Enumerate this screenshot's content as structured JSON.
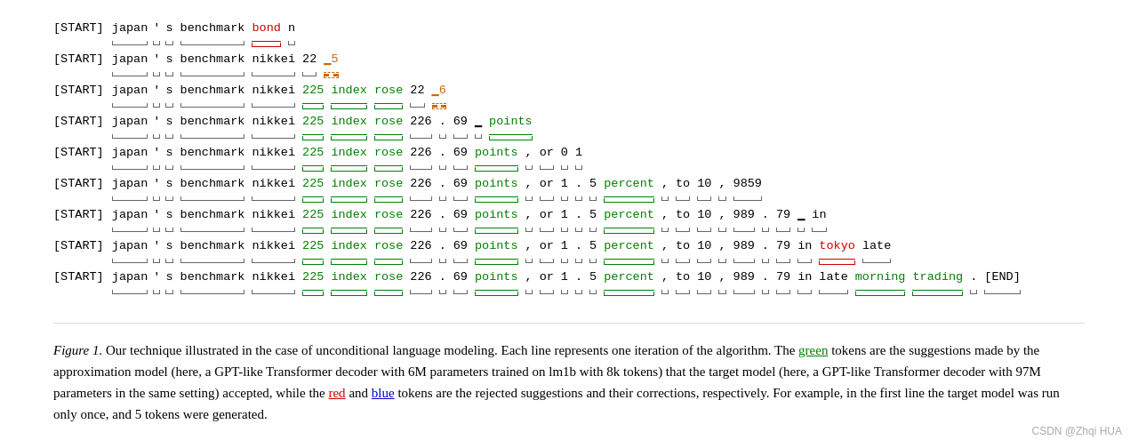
{
  "watermark": "CSDN @Zhqi HUA",
  "figure_number": "Figure 1.",
  "caption": "Our technique illustrated in the case of unconditional language modeling. Each line represents one iteration of the algorithm. The green tokens are the suggestions made by the approximation model (here, a GPT-like Transformer decoder with 6M parameters trained on lm1b with 8k tokens) that the target model (here, a GPT-like Transformer decoder with 97M parameters in the same setting) accepted, while the red and blue tokens are the rejected suggestions and their corrections, respectively. For example, in the first line the target model was run only once, and 5 tokens were generated.",
  "colors": {
    "green": "#008000",
    "red": "#cc0000",
    "blue": "#0000cc",
    "orange": "#cc6600"
  }
}
